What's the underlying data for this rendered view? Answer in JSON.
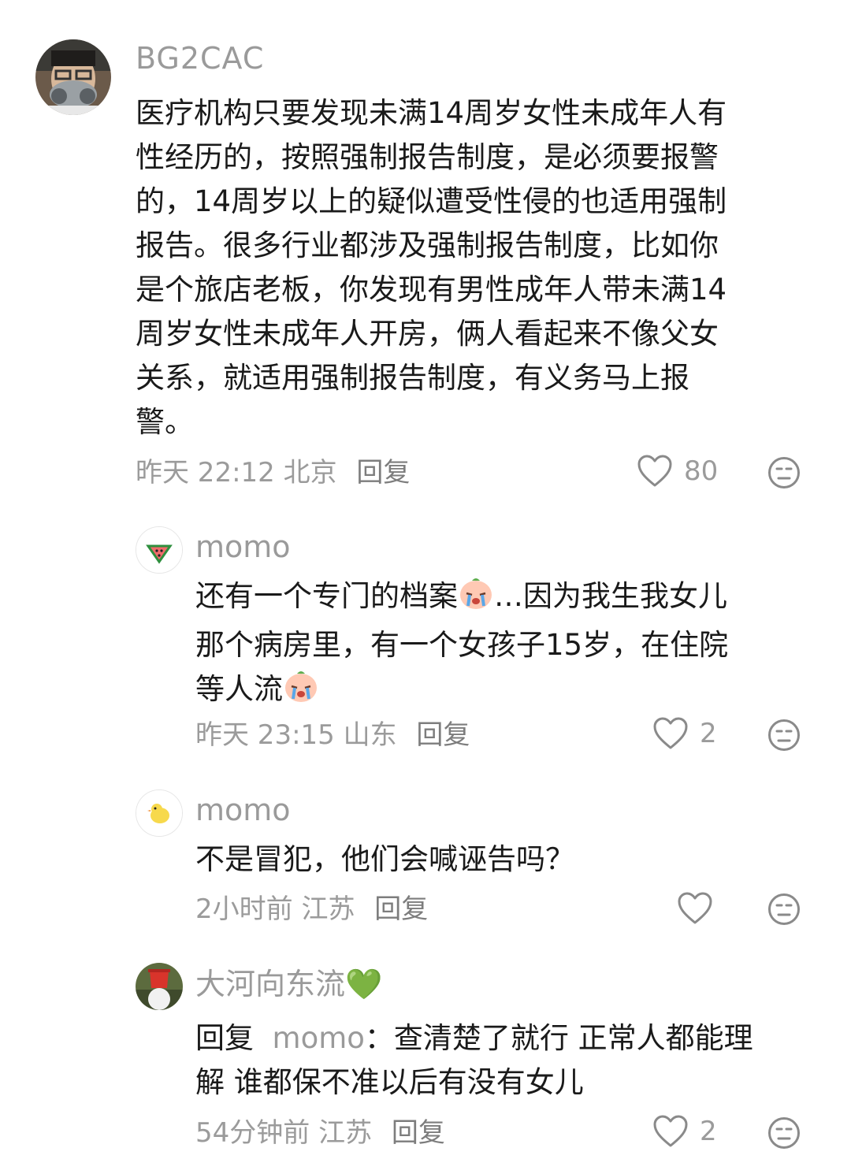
{
  "comments": [
    {
      "username": "BG2CAC",
      "text": "医疗机构只要发现未满14周岁女性未成年人有性经历的，按照强制报告制度，是必须要报警的，14周岁以上的疑似遭受性侵的也适用强制报告。很多行业都涉及强制报告制度，比如你是个旅店老板，你发现有男性成年人带未满14周岁女性未成年人开房，俩人看起来不像父女关系，就适用强制报告制度，有义务马上报警。",
      "lines": [
        "医疗机构只要发现未满14周岁女性未成年人有",
        "性经历的，按照强制报告制度，是必须要报警",
        "的，14周岁以上的疑似遭受性侵的也适用强制",
        "报告。很多行业都涉及强制报告制度，比如你",
        "是个旅店老板，你发现有男性成年人带未满14",
        "周岁女性未成年人开房，俩人看起来不像父女",
        "关系，就适用强制报告制度，有义务马上报",
        "警。"
      ],
      "time": "昨天 22:12",
      "location": "北京",
      "reply_label": "回复",
      "likes": "80",
      "avatar": "man-with-respirator-mask"
    },
    {
      "username": "momo",
      "line1_a": "还有一个专门的档案",
      "line1_b": "…因为我生我女儿",
      "line2": "那个病房里，有一个女孩子15岁，在住院",
      "line3": "等人流",
      "time": "昨天 23:15",
      "location": "山东",
      "reply_label": "回复",
      "likes": "2",
      "avatar": "watermelon-slice"
    },
    {
      "username": "momo",
      "text": "不是冒犯，他们会喊诬告吗？",
      "time": "2小时前",
      "location": "江苏",
      "reply_label": "回复",
      "likes": "",
      "avatar": "yellow-chick"
    },
    {
      "username": "大河向东流💚",
      "reply_prefix": "回复",
      "reply_target": "momo",
      "line1": "：查清楚了就行 正常人都能理",
      "line2": "解 谁都保不准以后有没有女儿",
      "time": "54分钟前",
      "location": "江苏",
      "reply_label": "回复",
      "likes": "2",
      "avatar": "red-bucket-head"
    }
  ],
  "icons": {
    "like": "heart-outline-icon",
    "dislike": "meh-face-icon",
    "crying_emoji": "crying-face-emoji"
  },
  "colors": {
    "text": "#1a1a1a",
    "secondary": "#9b9b9b",
    "icon_stroke": "#8a8a8a"
  }
}
